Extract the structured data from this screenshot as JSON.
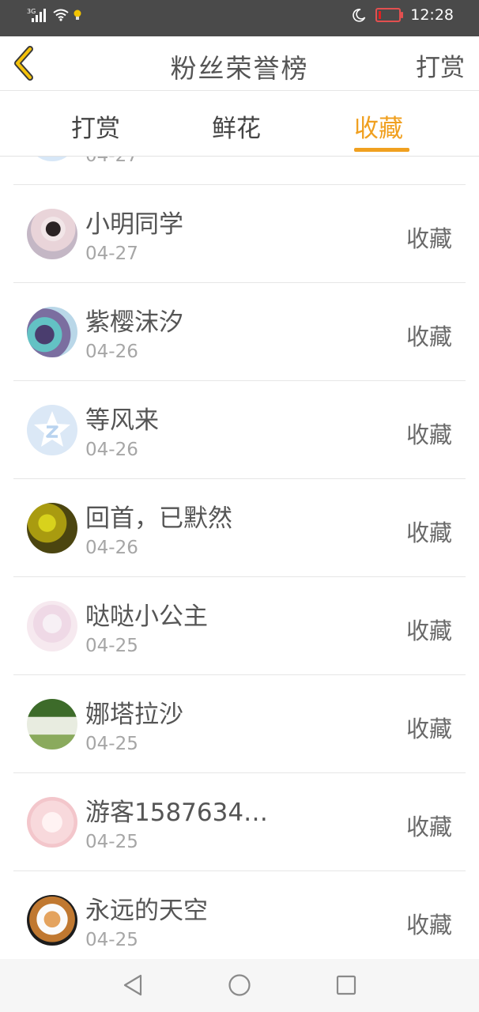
{
  "status_bar": {
    "network": "3G",
    "time": "12:28"
  },
  "header": {
    "title": "粉丝荣誉榜",
    "right_action": "打赏"
  },
  "tabs": [
    {
      "label": "打赏"
    },
    {
      "label": "鲜花"
    },
    {
      "label": "收藏"
    }
  ],
  "active_tab_color": "#f0a020",
  "partial_item": {
    "date": "04-27"
  },
  "items": [
    {
      "name": "小明同学",
      "date": "04-27",
      "action": "收藏"
    },
    {
      "name": "紫樱沫汐",
      "date": "04-26",
      "action": "收藏"
    },
    {
      "name": "等风来",
      "date": "04-26",
      "action": "收藏"
    },
    {
      "name": "回首，已默然",
      "date": "04-26",
      "action": "收藏"
    },
    {
      "name": "哒哒小公主",
      "date": "04-25",
      "action": "收藏"
    },
    {
      "name": "娜塔拉沙",
      "date": "04-25",
      "action": "收藏"
    },
    {
      "name": "游客1587634…",
      "date": "04-25",
      "action": "收藏"
    },
    {
      "name": "永远的天空",
      "date": "04-25",
      "action": "收藏"
    }
  ]
}
